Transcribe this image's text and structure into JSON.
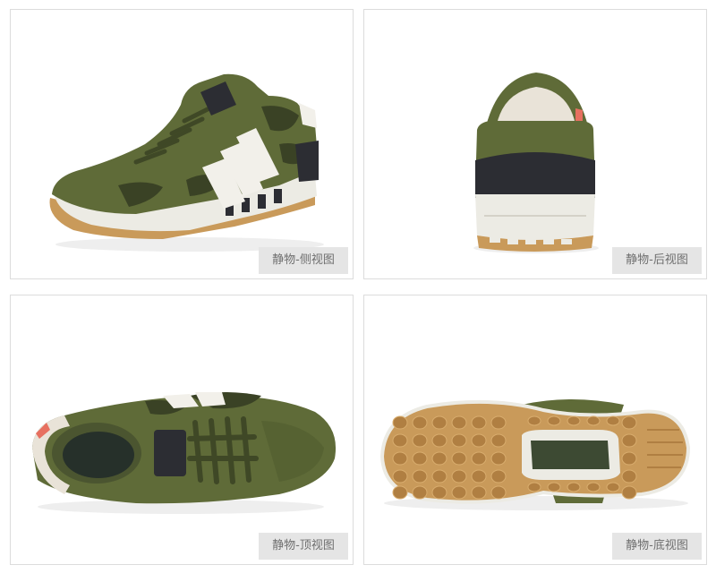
{
  "panels": [
    {
      "caption": "静物-侧视图",
      "view": "side"
    },
    {
      "caption": "静物-后视图",
      "view": "back"
    },
    {
      "caption": "静物-顶视图",
      "view": "top"
    },
    {
      "caption": "静物-底视图",
      "view": "bottom"
    }
  ],
  "colors": {
    "upper_olive": "#5f6b38",
    "olive_dark": "#4b5530",
    "camo_dark": "#3a4225",
    "stripe_white": "#f2f0ea",
    "heel_black": "#2c2d33",
    "midsole": "#ecebe4",
    "gum_sole": "#c99a5a",
    "caption_bg": "#e5e5e5"
  }
}
